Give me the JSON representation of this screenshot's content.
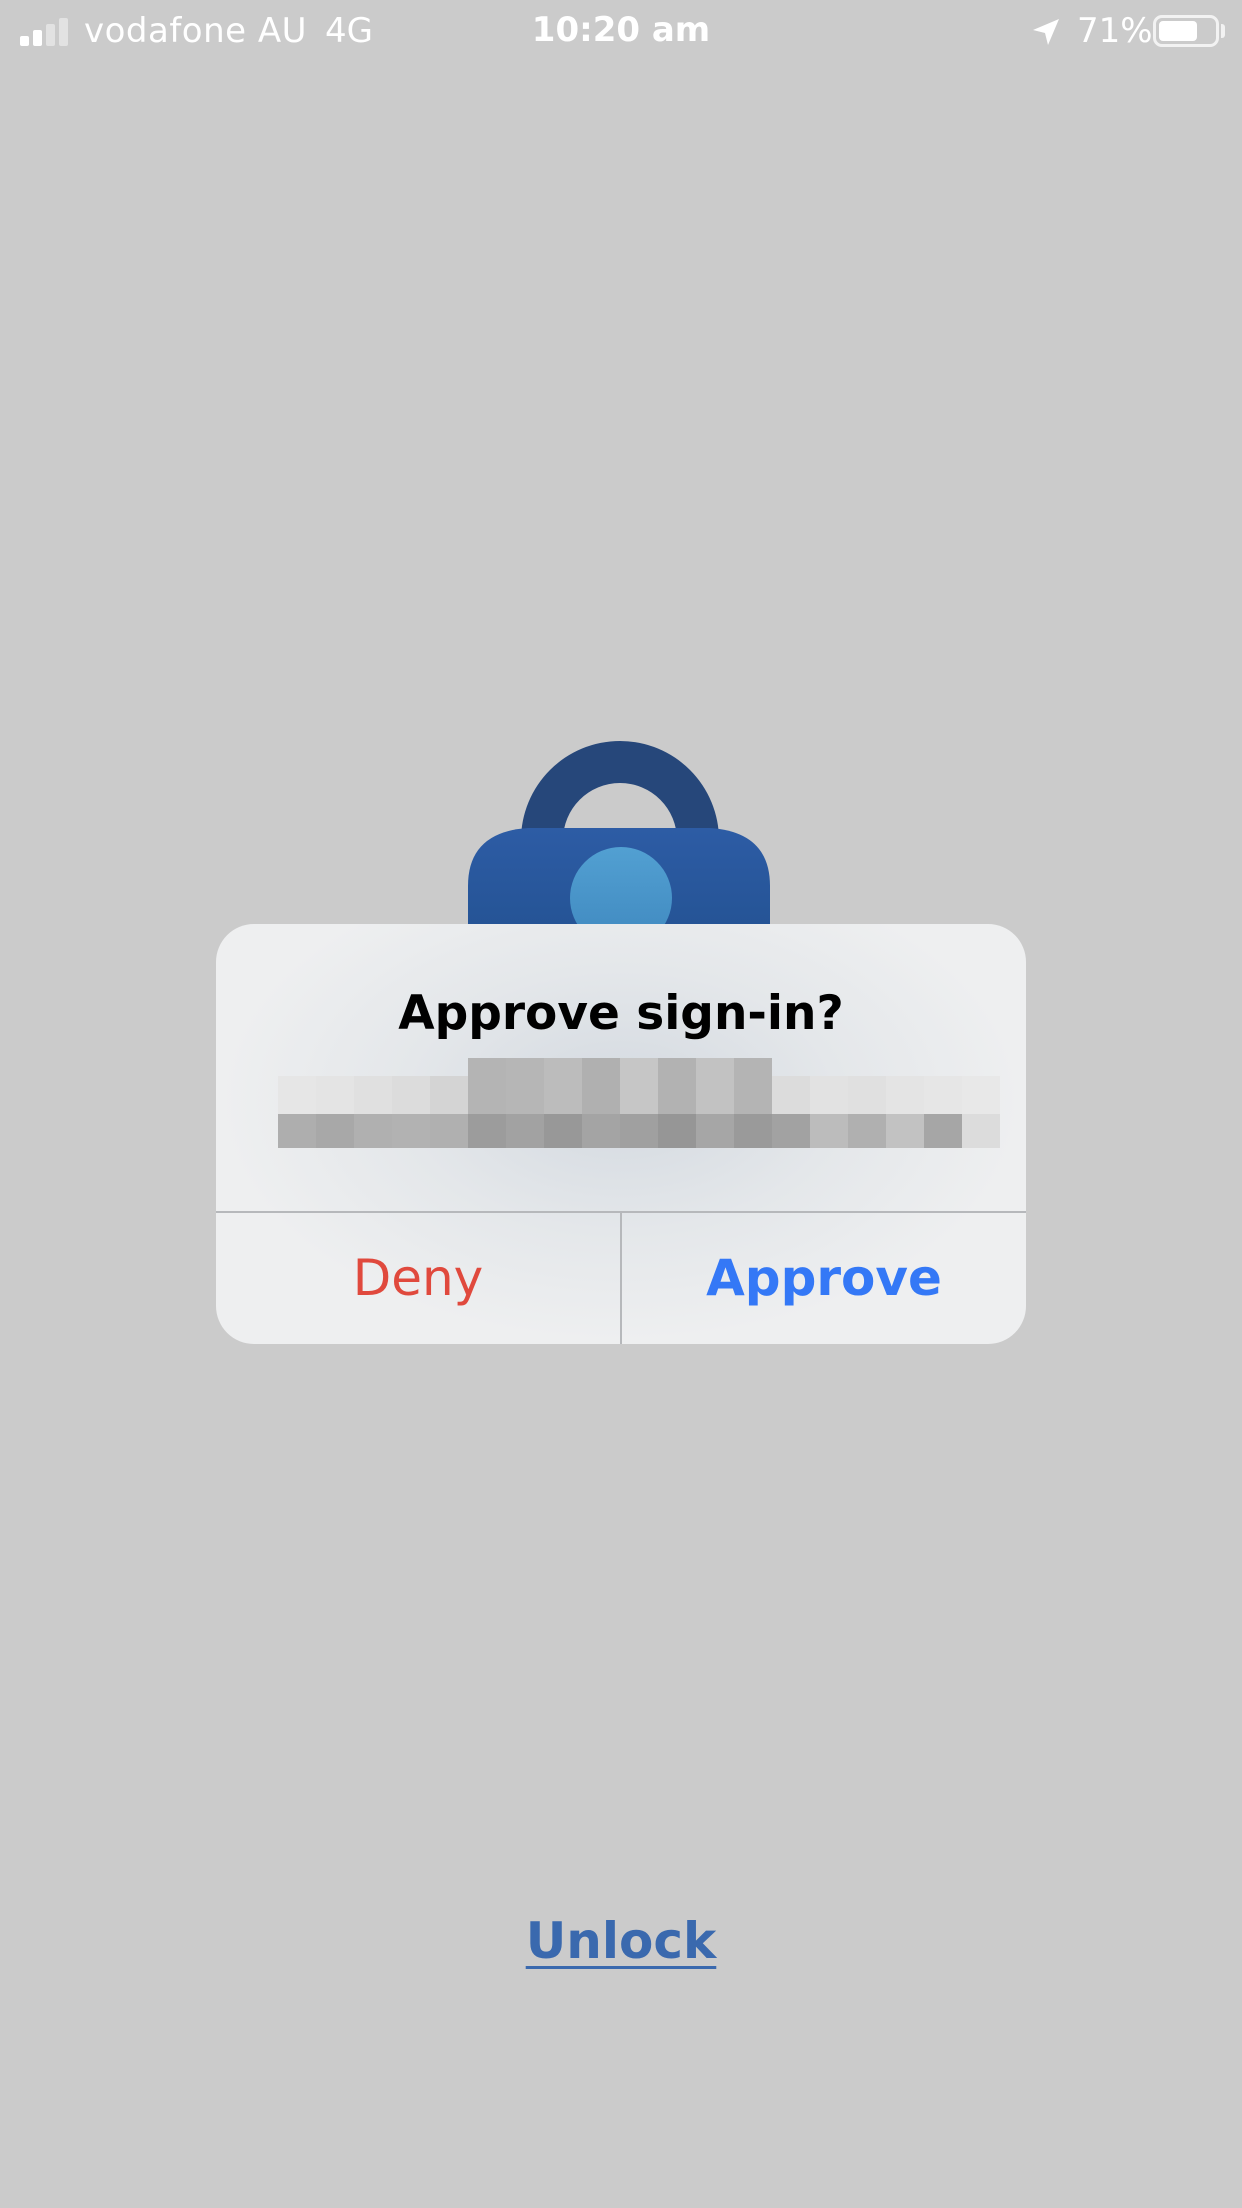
{
  "status_bar": {
    "carrier": "vodafone AU",
    "network": "4G",
    "time": "10:20 am",
    "battery_percent_label": "71%",
    "battery_level": 0.71,
    "signal_bars_active": 2,
    "signal_bars_total": 4,
    "icons": {
      "signal": "signal-strength-icon",
      "location": "location-arrow-icon",
      "battery": "battery-icon"
    }
  },
  "illustration": {
    "icon": "padlock-icon",
    "colors": {
      "shackle": "#26477a",
      "body": "#2f5ea5",
      "keyhole": "#4a93c6"
    }
  },
  "alert": {
    "title": "Approve sign-in?",
    "message_redacted": true,
    "deny_label": "Deny",
    "approve_label": "Approve"
  },
  "footer": {
    "unlock_label": "Unlock"
  },
  "colors": {
    "background": "#cbcbcb",
    "deny": "#e0493d",
    "approve": "#3478f6",
    "unlock_link": "#3a69ae"
  }
}
